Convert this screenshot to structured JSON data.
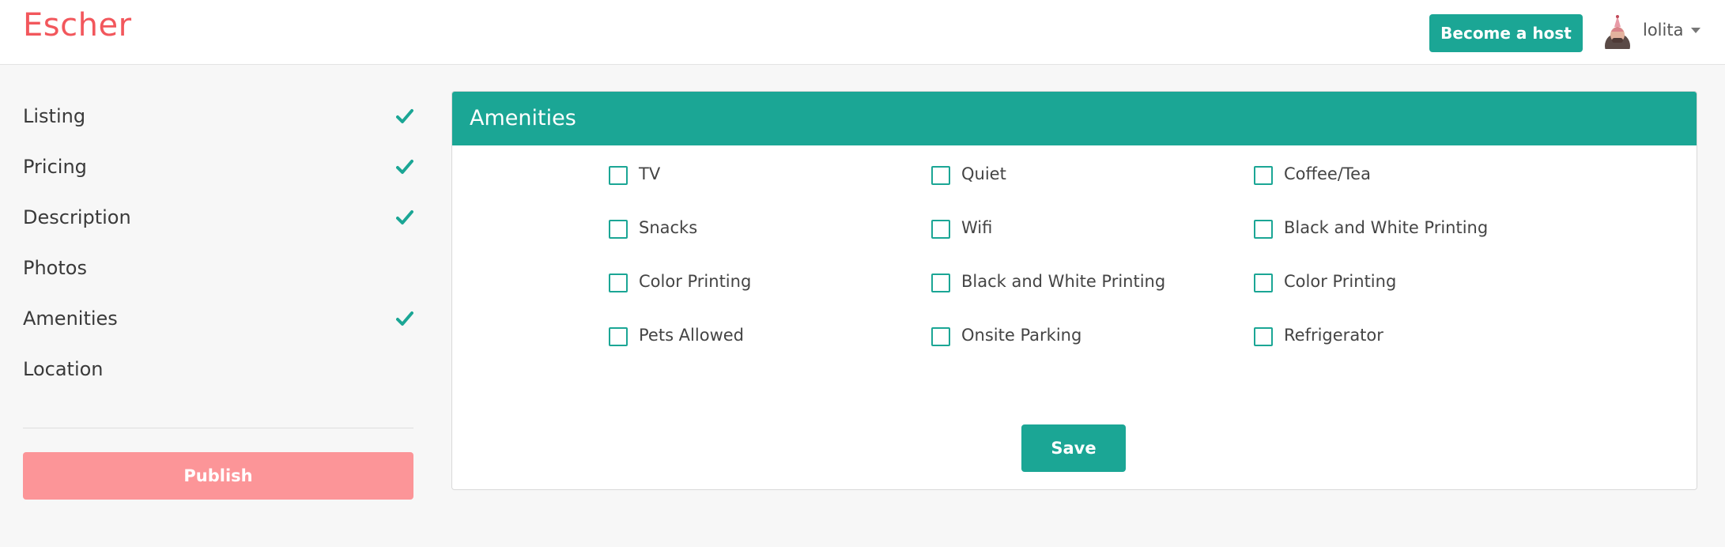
{
  "header": {
    "brand": "Escher",
    "become_host_label": "Become a host",
    "user_name": "lolita",
    "avatar_icon": "user-avatar"
  },
  "sidebar": {
    "items": [
      {
        "label": "Listing",
        "completed": true
      },
      {
        "label": "Pricing",
        "completed": true
      },
      {
        "label": "Description",
        "completed": true
      },
      {
        "label": "Photos",
        "completed": false
      },
      {
        "label": "Amenities",
        "completed": true
      },
      {
        "label": "Location",
        "completed": false
      }
    ],
    "publish_label": "Publish"
  },
  "panel": {
    "title": "Amenities",
    "amenities": [
      {
        "label": "TV",
        "checked": false
      },
      {
        "label": "Quiet",
        "checked": false
      },
      {
        "label": "Coffee/Tea",
        "checked": false
      },
      {
        "label": "Snacks",
        "checked": false
      },
      {
        "label": "Wifi",
        "checked": false
      },
      {
        "label": "Black and White Printing",
        "checked": false
      },
      {
        "label": "Color Printing",
        "checked": false
      },
      {
        "label": "Black and White Printing",
        "checked": false
      },
      {
        "label": "Color Printing",
        "checked": false
      },
      {
        "label": "Pets Allowed",
        "checked": false
      },
      {
        "label": "Onsite Parking",
        "checked": false
      },
      {
        "label": "Refrigerator",
        "checked": false
      }
    ],
    "save_label": "Save"
  },
  "colors": {
    "brand": "#f2575c",
    "accent": "#1ba695",
    "publish": "#fc9598",
    "background": "#f7f7f7"
  }
}
